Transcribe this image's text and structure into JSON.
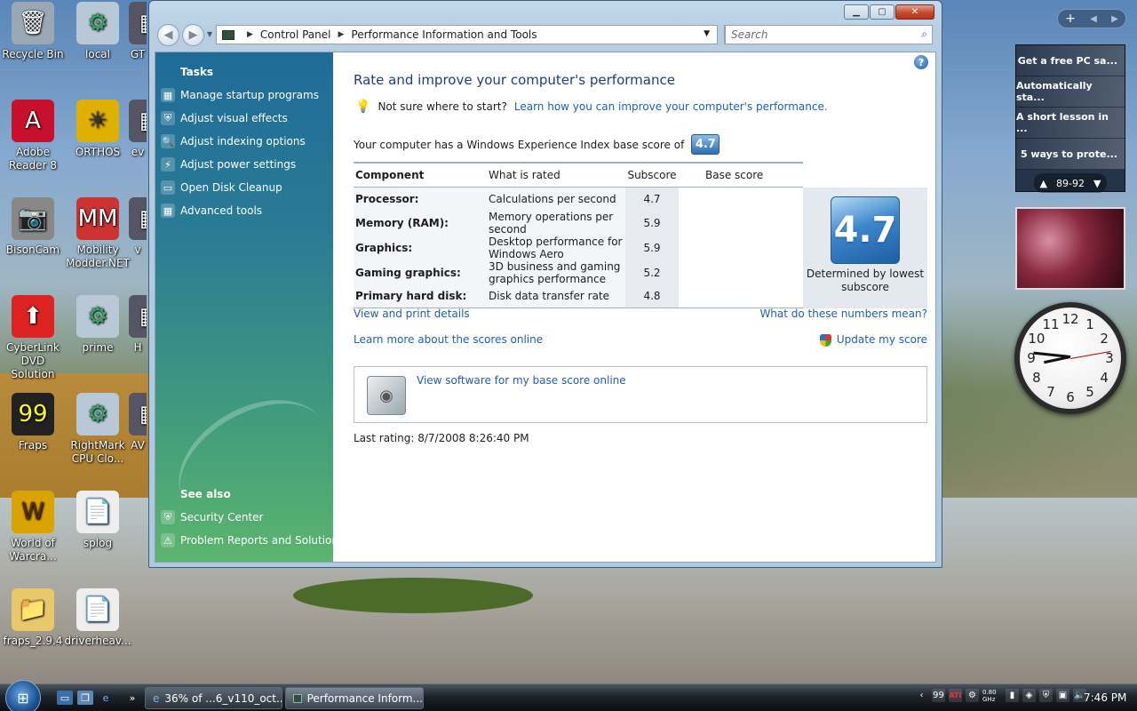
{
  "desktop": {
    "icons": [
      {
        "label": "Recycle Bin",
        "glyph": "🗑"
      },
      {
        "label": "local",
        "glyph": "⚙"
      },
      {
        "label": "GT",
        "glyph": "▦"
      },
      {
        "label": "Adobe Reader 8",
        "glyph": "A"
      },
      {
        "label": "ORTHOS",
        "glyph": "☀"
      },
      {
        "label": "ev",
        "glyph": "▦"
      },
      {
        "label": "BisonCam",
        "glyph": "📷"
      },
      {
        "label": "Mobility Modder.NET",
        "glyph": "MM"
      },
      {
        "label": "v",
        "glyph": "▦"
      },
      {
        "label": "CyberLink DVD Solution",
        "glyph": "⬆"
      },
      {
        "label": "prime",
        "glyph": "⚙"
      },
      {
        "label": "H",
        "glyph": "▦"
      },
      {
        "label": "Fraps",
        "glyph": "99"
      },
      {
        "label": "RightMark CPU Clo...",
        "glyph": "⚙"
      },
      {
        "label": "AV",
        "glyph": "▦"
      },
      {
        "label": "World of Warcra...",
        "glyph": "W"
      },
      {
        "label": "splog",
        "glyph": "📄"
      },
      {
        "label": "fraps_2.9.4",
        "glyph": "📁"
      },
      {
        "label": "driverheav...",
        "glyph": "📄"
      }
    ]
  },
  "window": {
    "breadcrumb": [
      "Control Panel",
      "Performance Information and Tools"
    ],
    "search_placeholder": "Search",
    "tasks_title": "Tasks",
    "tasks": [
      {
        "label": "Manage startup programs",
        "icon": "▦"
      },
      {
        "label": "Adjust visual effects",
        "icon": "⛨"
      },
      {
        "label": "Adjust indexing options",
        "icon": "🔍"
      },
      {
        "label": "Adjust power settings",
        "icon": "⚡"
      },
      {
        "label": "Open Disk Cleanup",
        "icon": "▭"
      },
      {
        "label": "Advanced tools",
        "icon": "▦"
      }
    ],
    "see_also_title": "See also",
    "see_also": [
      {
        "label": "Security Center",
        "icon": "⛨"
      },
      {
        "label": "Problem Reports and Solutions",
        "icon": "⚠"
      }
    ],
    "main": {
      "title": "Rate and improve your computer's performance",
      "hint_text": "Not sure where to start?",
      "hint_link": "Learn how you can improve your computer's performance.",
      "base_line": "Your computer has a Windows Experience Index base score of",
      "base_score": "4.7",
      "columns": [
        "Component",
        "What is rated",
        "Subscore",
        "Base score"
      ],
      "rows": [
        {
          "component": "Processor:",
          "rated": "Calculations per second",
          "subscore": "4.7"
        },
        {
          "component": "Memory (RAM):",
          "rated": "Memory operations per second",
          "subscore": "5.9"
        },
        {
          "component": "Graphics:",
          "rated": "Desktop performance for Windows Aero",
          "subscore": "5.9"
        },
        {
          "component": "Gaming graphics:",
          "rated": "3D business and gaming graphics performance",
          "subscore": "5.2"
        },
        {
          "component": "Primary hard disk:",
          "rated": "Disk data transfer rate",
          "subscore": "4.8"
        }
      ],
      "determined_by": "Determined by lowest subscore",
      "link_view_print": "View and print details",
      "link_numbers_mean": "What do these numbers mean?",
      "link_learn_more": "Learn more about the scores online",
      "link_update": "Update my score",
      "link_software": "View software for my base score online",
      "last_rating": "Last rating: 8/7/2008 8:26:40 PM"
    }
  },
  "sidebar": {
    "feeds": [
      "Get a free PC sa...",
      "Automatically sta...",
      "A short lesson in ...",
      "5 ways to prote..."
    ],
    "feed_range": "89-92",
    "clock_numbers": [
      "12",
      "1",
      "2",
      "3",
      "4",
      "5",
      "6",
      "7",
      "8",
      "9",
      "10",
      "11"
    ]
  },
  "taskbar": {
    "buttons": [
      "36% of ...6_v110_oct...",
      "Performance Inform..."
    ],
    "time": "7:46 PM",
    "tray_speed": "0.80 GHz"
  }
}
